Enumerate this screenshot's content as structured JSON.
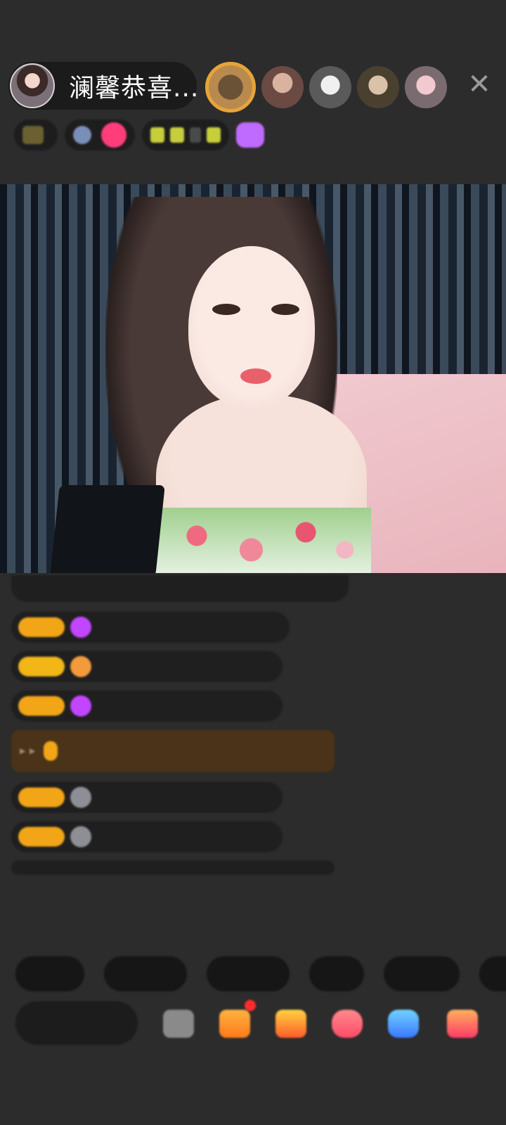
{
  "header": {
    "host_name": "澜馨恭喜...",
    "close_icon": "close-icon",
    "viewer_avatars": [
      "rank1",
      "a2",
      "a3",
      "a4",
      "a5"
    ]
  },
  "stats": {
    "chip1": "",
    "chip2": "",
    "task_tags": [
      "",
      "",
      "",
      ""
    ]
  },
  "chat": {
    "top_line": "",
    "messages": [
      {
        "level": "",
        "badge": "purple",
        "user": "",
        "text": ""
      },
      {
        "level": "",
        "badge": "orange",
        "user": "",
        "text": ""
      },
      {
        "level": "",
        "badge": "purple",
        "user": "",
        "text": ""
      },
      {
        "level": "",
        "badge": "gray",
        "user": "",
        "text": ""
      },
      {
        "level": "",
        "badge": "gray",
        "user": "",
        "text": ""
      }
    ],
    "highlight": {
      "tag": "",
      "text": ""
    },
    "notice": ""
  },
  "quick_replies": [
    "",
    "",
    "",
    "",
    "",
    ""
  ],
  "bottom_bar": {
    "input_placeholder": "",
    "icons": [
      "more-icon",
      "gift-box-icon",
      "treasure-icon",
      "heart-icon",
      "game-icon",
      "gift-icon"
    ]
  },
  "colors": {
    "background": "#2c2c2c",
    "level_badge": "#f2a516",
    "accent_pink": "#ff3d7a",
    "accent_purple": "#c06bff"
  }
}
